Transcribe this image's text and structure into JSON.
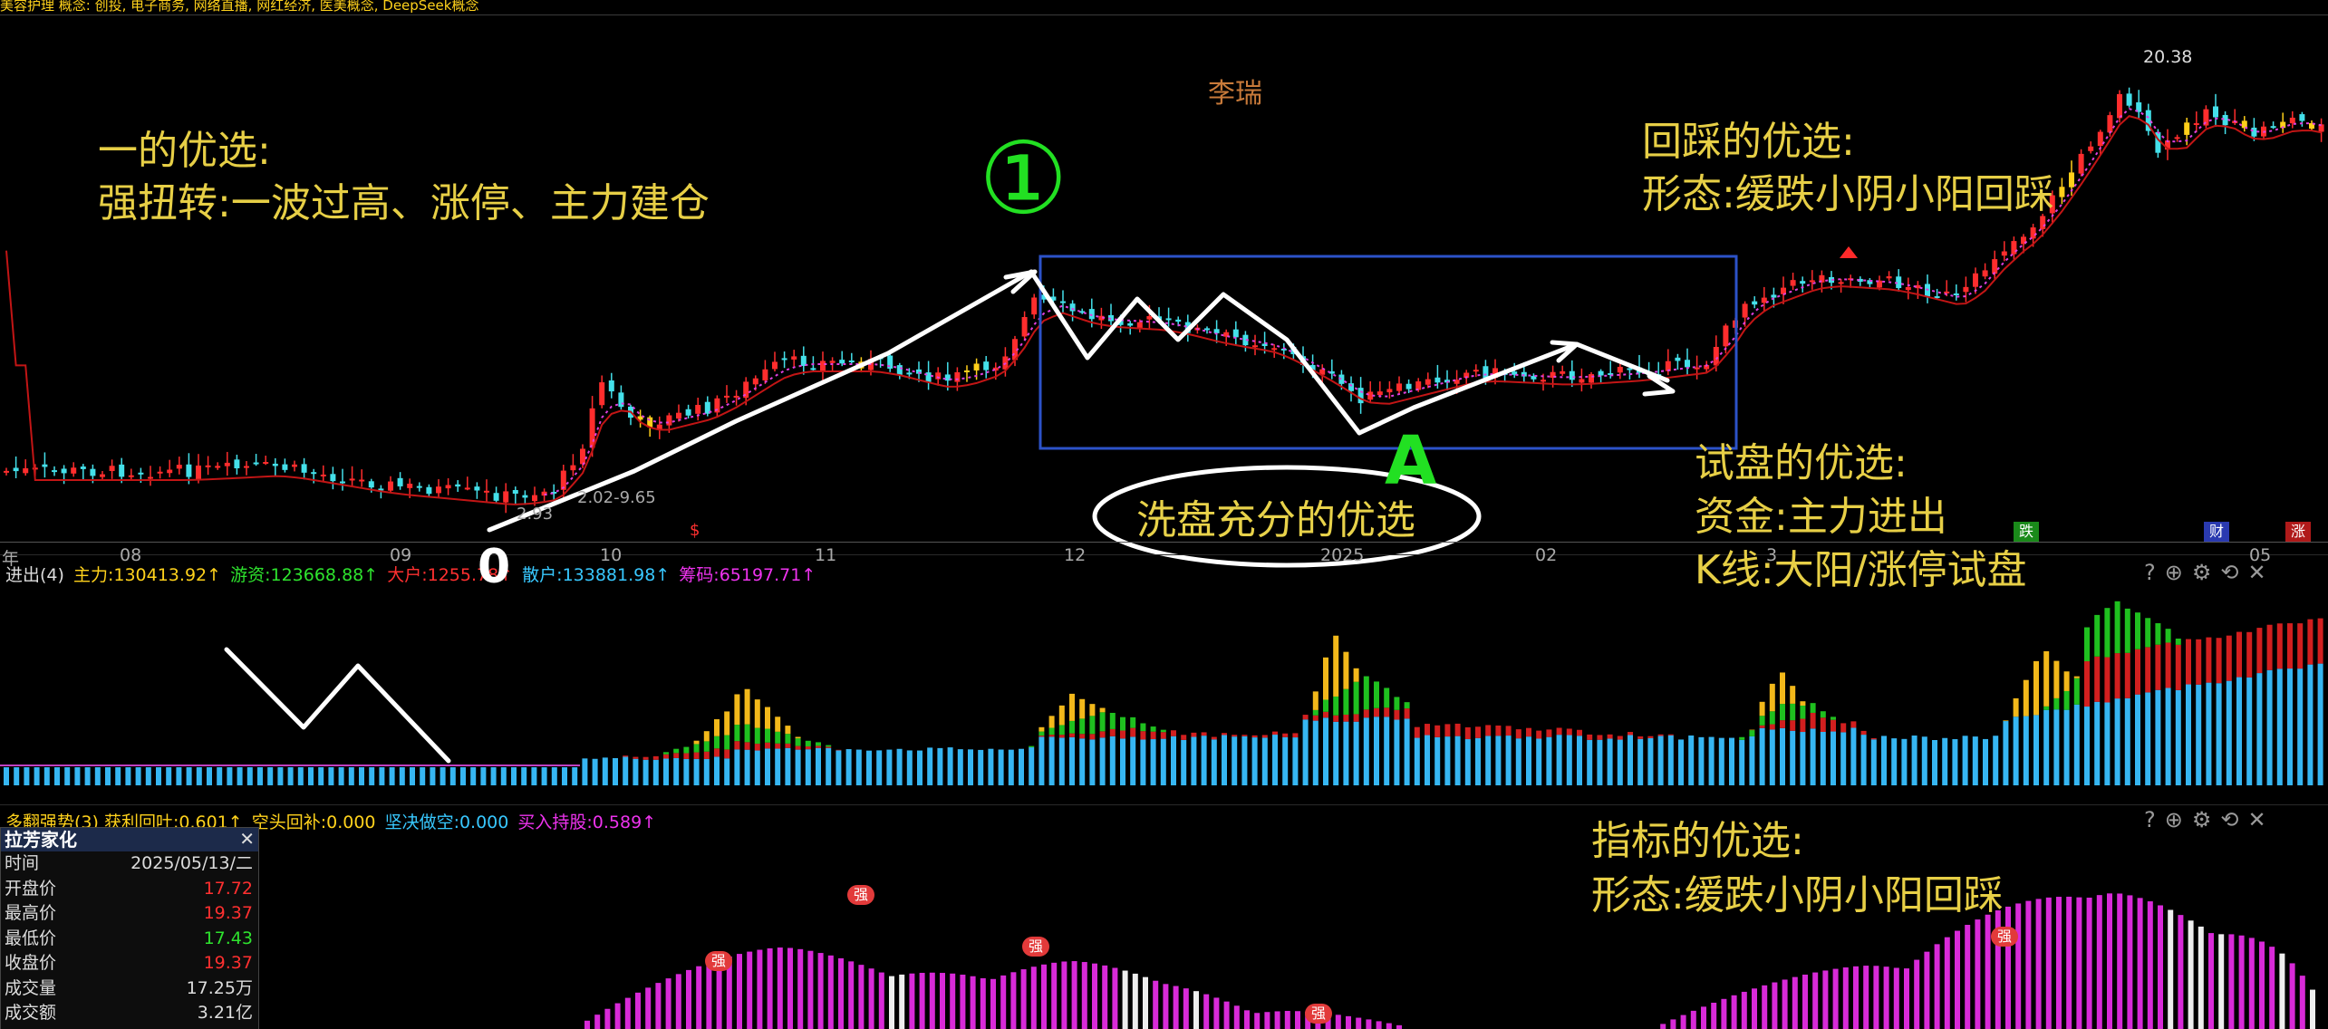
{
  "concept_bar": "美容护理  概念: 创投, 电子商务, 网络直播, 网红经济, 医美概念, DeepSeek概念",
  "watermark": "李瑞",
  "price_labels": {
    "high": "20.38",
    "low_range": "2.02-9.65",
    "low_left": "2.93"
  },
  "x_axis": [
    "年",
    "08",
    "09",
    "10",
    "11",
    "12",
    "2025",
    "02",
    "3",
    "05"
  ],
  "indicator1": {
    "prefix": "进出(4)",
    "items": [
      {
        "label": "主力:130413.92↑",
        "color": "#ffd21c"
      },
      {
        "label": "游资:123668.88↑",
        "color": "#2ee32e"
      },
      {
        "label": "大户:1255.78↑",
        "color": "#ff3030"
      },
      {
        "label": "散户:133881.98↑",
        "color": "#38c8ff"
      },
      {
        "label": "筹码:65197.71↑",
        "color": "#ee33ee"
      }
    ]
  },
  "indicator2": {
    "items": [
      {
        "label": "多翻强势(3) 获利回吐:0.601↑",
        "color": "#ffd21c"
      },
      {
        "label": "空头回补:0.000",
        "color": "#ffd21c"
      },
      {
        "label": "坚决做空:0.000",
        "color": "#38c8ff"
      },
      {
        "label": "买入持股:0.589↑",
        "color": "#ee33ee"
      }
    ]
  },
  "tags": {
    "die": "跌",
    "cai": "财",
    "zhang": "涨",
    "qiang": "强",
    "s": "$"
  },
  "info_panel": {
    "title": "拉芳家化",
    "rows": [
      {
        "label": "时间",
        "value": "2025/05/13/二",
        "color": "#dddddd"
      },
      {
        "label": "开盘价",
        "value": "17.72",
        "color": "#ff3030"
      },
      {
        "label": "最高价",
        "value": "19.37",
        "color": "#ff3030"
      },
      {
        "label": "最低价",
        "value": "17.43",
        "color": "#2ee32e"
      },
      {
        "label": "收盘价",
        "value": "19.37",
        "color": "#ff3030"
      },
      {
        "label": "成交量",
        "value": "17.25万",
        "color": "#dddddd"
      },
      {
        "label": "成交额",
        "value": "3.21亿",
        "color": "#dddddd"
      }
    ]
  },
  "annotations": {
    "one": [
      "一的优选:",
      "强扭转:一波过高、涨停、主力建仓"
    ],
    "pullback": [
      "回踩的优选:",
      "形态:缓跌小阴小阳回踩"
    ],
    "wash": "洗盘充分的优选",
    "test": [
      "试盘的优选:",
      "资金:主力进出",
      "K线:大阳/涨停试盘"
    ],
    "indicator": [
      "指标的优选:",
      "形态:缓跌小阴小阳回踩"
    ],
    "marks": {
      "zero": "0",
      "one": "①",
      "a": "A"
    }
  },
  "chart_data": [
    {
      "type": "candlestick",
      "title": "",
      "x_labels": [
        "年",
        "08",
        "09",
        "10",
        "11",
        "12",
        "2025",
        "02",
        "3",
        "05"
      ],
      "close_path": [
        3.0,
        2.9,
        2.9,
        2.8,
        2.7,
        2.5,
        4.5,
        6.0,
        7.0,
        8.5,
        9.6,
        8.8,
        8.0,
        7.4,
        7.9,
        8.2,
        7.6,
        7.8,
        7.4,
        8.1,
        8.8,
        10.5,
        12.5,
        15.5,
        17.5,
        18.5,
        16.5,
        18.0,
        19.37
      ],
      "high": 20.38,
      "yrange_label": "2.02-9.65"
    },
    {
      "type": "bar",
      "title": "",
      "series": [
        {
          "name": "主力",
          "last": 130413.92
        },
        {
          "name": "游资",
          "last": 123668.88
        },
        {
          "name": "大户",
          "last": 1255.78
        },
        {
          "name": "散户",
          "last": 133881.98
        },
        {
          "name": "筹码",
          "last": 65197.71
        }
      ]
    },
    {
      "type": "bar",
      "title": "",
      "series": [
        {
          "name": "获利回吐",
          "last": 0.601
        },
        {
          "name": "空头回补",
          "last": 0.0
        },
        {
          "name": "坚决做空",
          "last": 0.0
        },
        {
          "name": "买入持股",
          "last": 0.589
        }
      ]
    }
  ]
}
